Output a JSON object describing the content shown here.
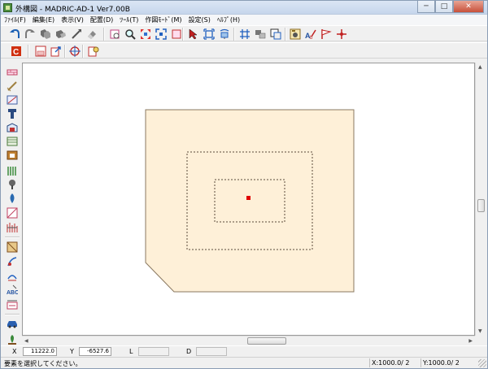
{
  "window": {
    "title": "外構図 - MADRIC-AD-1 Ver7.00B",
    "minimize_glyph": "─",
    "maximize_glyph": "□",
    "close_glyph": "✕"
  },
  "menu": [
    {
      "label": "ﾌｧｲﾙ(F)"
    },
    {
      "label": "編集(E)"
    },
    {
      "label": "表示(V)"
    },
    {
      "label": "配置(D)"
    },
    {
      "label": "ﾂｰﾙ(T)"
    },
    {
      "label": "作図ﾓｰﾄﾞ(M)"
    },
    {
      "label": "設定(S)"
    },
    {
      "label": "ﾍﾙﾌﾟ(H)"
    }
  ],
  "toolbar1": [
    "undo-icon",
    "redo-icon",
    "copy-shapes-icon",
    "paste-shapes-icon",
    "draw-line-icon",
    "eraser-icon",
    "print-preview-icon",
    "zoom-icon",
    "fit-view-icon",
    "zoom-all-icon",
    "frame-icon",
    "select-arrow-icon",
    "fit-width-icon",
    "rotate-view-icon",
    "grid-icon",
    "layer-icon",
    "snapshot-icon",
    "camera-icon",
    "text-style-icon",
    "flag-icon",
    "crosshair-icon"
  ],
  "toolbar2": [
    "cad-command-icon",
    "save-icon",
    "export-icon",
    "target-icon",
    "settings-icon"
  ],
  "palette": [
    "block-wall-icon",
    "fence-icon",
    "gate-icon",
    "pillar-icon",
    "carport-icon",
    "deck-icon",
    "storage-icon",
    "fence-panel-icon",
    "tree-icon",
    "plant-icon",
    "slope-icon",
    "stairs-icon",
    "paving-icon",
    "lawn-icon",
    "pond-icon",
    "text-tool-icon",
    "dimension-icon",
    "car-icon",
    "plant-material-icon"
  ],
  "colors": {
    "lot_fill": "#fef0d8",
    "lot_stroke": "#8a7860",
    "dash": "#5a4a3a",
    "marker": "#e00000"
  },
  "coords": {
    "x_label": "X",
    "x_value": "11222.0",
    "y_label": "Y",
    "y_value": "-6527.6",
    "l_label": "L",
    "l_value": "",
    "d_label": "D",
    "d_value": ""
  },
  "status": {
    "message": "要素を選択してください。",
    "x_scale": "X:1000.0/ 2",
    "y_scale": "Y:1000.0/ 2"
  }
}
